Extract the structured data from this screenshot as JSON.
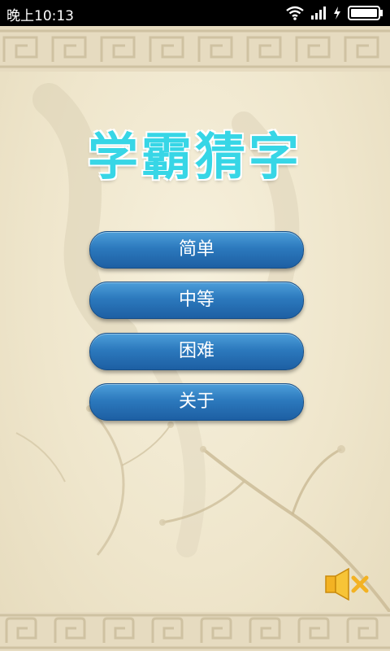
{
  "status_bar": {
    "time": "晚上10:13"
  },
  "app": {
    "title": "学霸猜字",
    "menu": [
      {
        "label": "简单"
      },
      {
        "label": "中等"
      },
      {
        "label": "困难"
      },
      {
        "label": "关于"
      }
    ],
    "sound_icon": "speaker-muted-icon",
    "colors": {
      "title": "#37d6e6",
      "button": "#2c79bd",
      "background": "#efe6cc"
    }
  }
}
